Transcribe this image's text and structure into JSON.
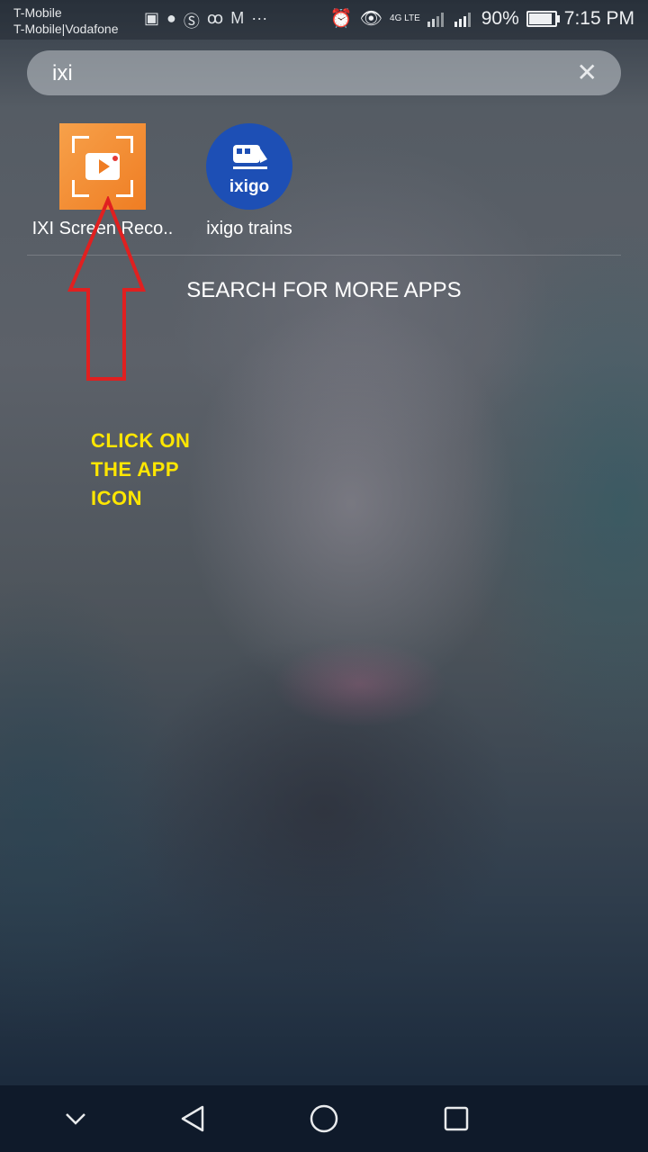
{
  "status_bar": {
    "carrier_line1": "T-Mobile",
    "carrier_line2": "T-Mobile|Vodafone",
    "notification_icons": [
      "screen-record-icon",
      "chat-icon",
      "skype-icon",
      "voicemail-icon",
      "gmail-icon",
      "more-dots-icon"
    ],
    "right_icons": [
      "alarm-icon",
      "eye-comfort-icon",
      "signal-4g-icon",
      "signal-roaming-icon"
    ],
    "network_label": "4G LTE",
    "battery_percent": "90%",
    "battery_level": 0.9,
    "time": "7:15 PM"
  },
  "search": {
    "query": "ixi",
    "clear_icon": "close-icon"
  },
  "results": [
    {
      "label": "IXI Screen Reco..",
      "icon": "ixi-screen-recorder-icon",
      "color": "#ef7d23"
    },
    {
      "label": "ixigo trains",
      "icon": "ixigo-trains-icon",
      "icon_text": "ixigo",
      "color": "#1d4fb5"
    }
  ],
  "search_more": "SEARCH FOR MORE APPS",
  "annotation": {
    "lines": [
      "CLICK ON",
      "THE APP",
      "ICON"
    ],
    "arrow_color": "#e02020",
    "text_color": "#ffe600"
  },
  "nav_bar": {
    "buttons": [
      "collapse-icon",
      "back-icon",
      "home-icon",
      "recents-icon"
    ]
  }
}
